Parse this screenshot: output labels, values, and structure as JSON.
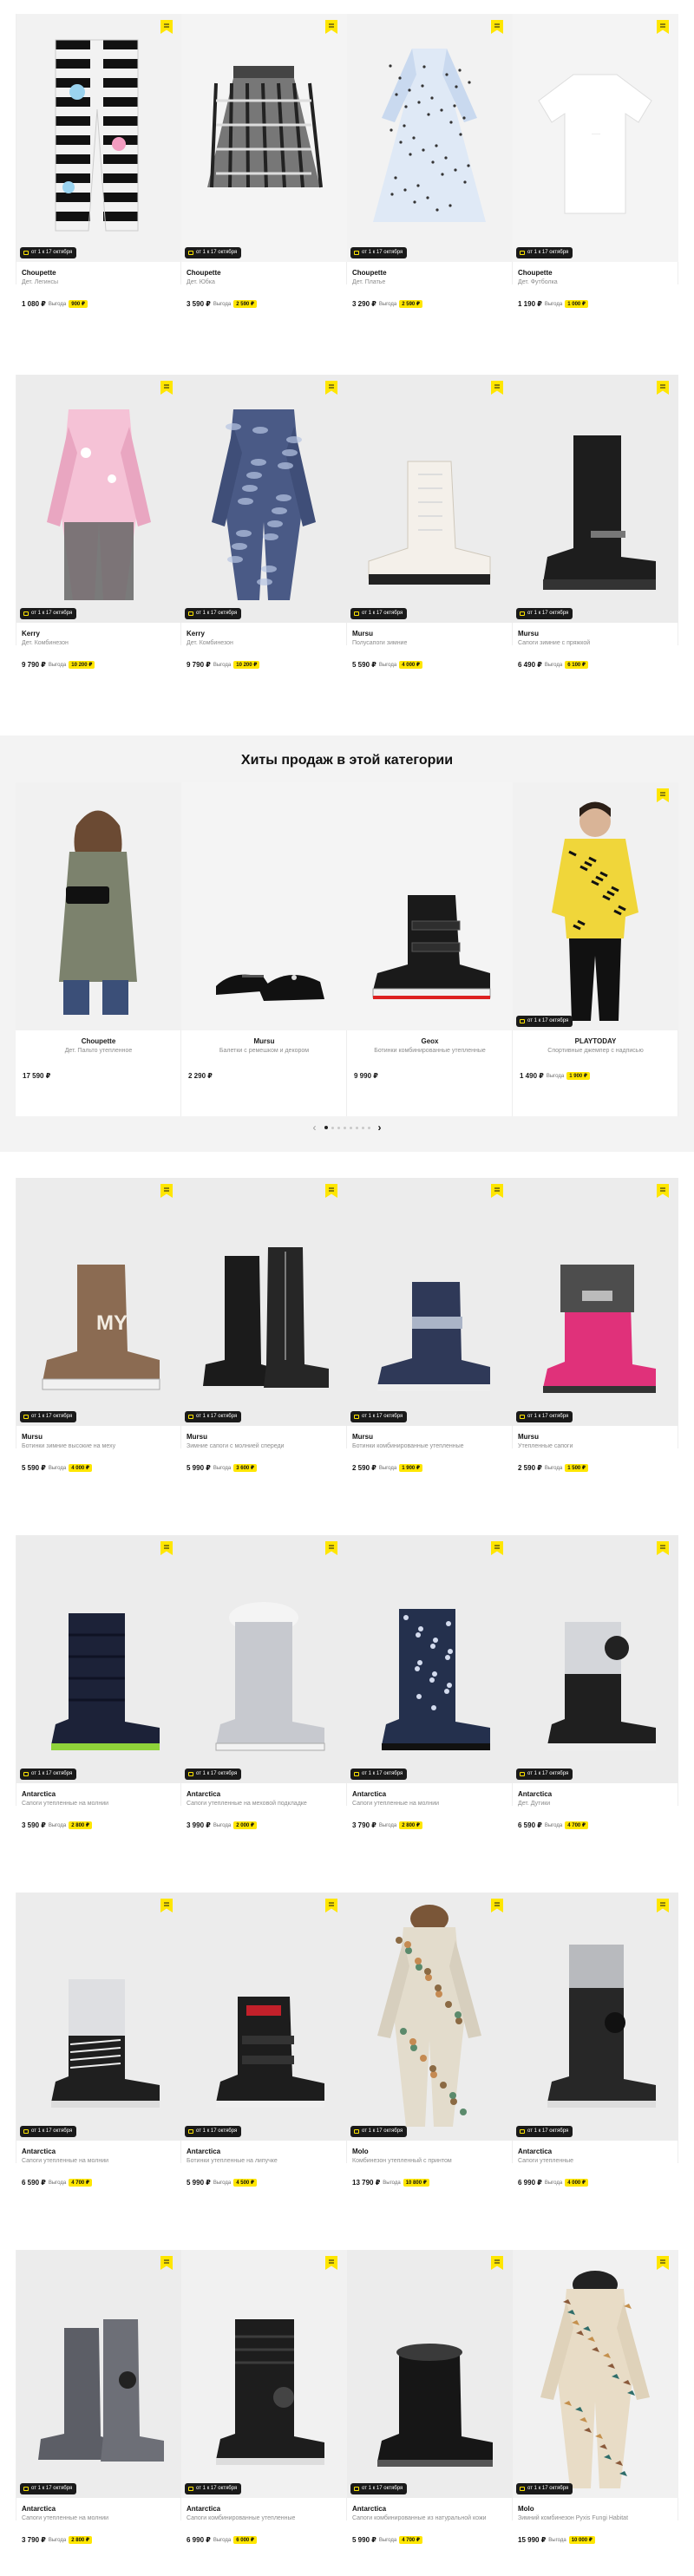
{
  "delivery_badge": "от 1 к 17 октября",
  "savings_label": "Выгода",
  "hits_title": "Хиты продаж в этой категории",
  "pager": {
    "prev": "‹",
    "next": "›",
    "count": 8,
    "active": 0
  },
  "rows": [
    [
      {
        "brand": "Choupette",
        "type": "Дет. Легинсы",
        "price": "1 080 ₽",
        "saving": "900 ₽",
        "kind": "leggings"
      },
      {
        "brand": "Choupette",
        "type": "Дет. Юбка",
        "price": "3 590 ₽",
        "saving": "2 590 ₽",
        "kind": "skirt"
      },
      {
        "brand": "Choupette",
        "type": "Дет. Платье",
        "price": "3 290 ₽",
        "saving": "2 590 ₽",
        "kind": "dress"
      },
      {
        "brand": "Choupette",
        "type": "Дет. Футболка",
        "price": "1 190 ₽",
        "saving": "1 000 ₽",
        "kind": "tshirt"
      }
    ],
    [
      {
        "brand": "Kerry",
        "type": "Дет. Комбинезон",
        "price": "9 790 ₽",
        "saving": "10 200 ₽",
        "kind": "snowsuit-pink"
      },
      {
        "brand": "Kerry",
        "type": "Дет. Комбинезон",
        "price": "9 790 ₽",
        "saving": "10 200 ₽",
        "kind": "snowsuit-camo"
      },
      {
        "brand": "Mursu",
        "type": "Полусапоги зимние",
        "price": "5 590 ₽",
        "saving": "4 000 ₽",
        "kind": "boot-white"
      },
      {
        "brand": "Mursu",
        "type": "Сапоги зимние с пряжкой",
        "price": "6 490 ₽",
        "saving": "6 100 ₽",
        "kind": "boot-tall-black"
      }
    ]
  ],
  "hits": [
    {
      "brand": "Choupette",
      "type": "Дет. Пальто утепленное",
      "price": "17 590 ₽",
      "saving": "",
      "kind": "girl-coat"
    },
    {
      "brand": "Mursu",
      "type": "Балетки с ремешком и декором",
      "price": "2 290 ₽",
      "saving": "",
      "kind": "ballet"
    },
    {
      "brand": "Geox",
      "type": "Ботинки комбинированные утепленные",
      "price": "9 990 ₽",
      "saving": "",
      "kind": "boot-geox"
    },
    {
      "brand": "PLAYTODAY",
      "type": "Спортивные джемпер с надписью",
      "price": "1 490 ₽",
      "saving": "1 900 ₽",
      "kind": "boy-yellow"
    }
  ],
  "rows2": [
    [
      {
        "brand": "Mursu",
        "type": "Ботинки зимние высокие на меху",
        "price": "5 590 ₽",
        "saving": "4 000 ₽",
        "kind": "boot-brown"
      },
      {
        "brand": "Mursu",
        "type": "Зимние сапоги с молнией спереди",
        "price": "5 990 ₽",
        "saving": "3 600 ₽",
        "kind": "boot-black-zip"
      },
      {
        "brand": "Mursu",
        "type": "Ботинки комбинированные утепленные",
        "price": "2 590 ₽",
        "saving": "1 900 ₽",
        "kind": "boot-navy"
      },
      {
        "brand": "Mursu",
        "type": "Утепленные сапоги",
        "price": "2 590 ₽",
        "saving": "1 500 ₽",
        "kind": "boot-pink"
      }
    ],
    [
      {
        "brand": "Antarctica",
        "type": "Сапоги утепленные на молнии",
        "price": "3 590 ₽",
        "saving": "2 800 ₽",
        "kind": "puffer-navy"
      },
      {
        "brand": "Antarctica",
        "type": "Сапоги утепленные на меховой подкладке",
        "price": "3 990 ₽",
        "saving": "2 000 ₽",
        "kind": "puffer-silver-fur"
      },
      {
        "brand": "Antarctica",
        "type": "Сапоги утепленные на молнии",
        "price": "3 790 ₽",
        "saving": "2 800 ₽",
        "kind": "puffer-print"
      },
      {
        "brand": "Antarctica",
        "type": "Дет. Дутики",
        "price": "6 590 ₽",
        "saving": "4 700 ₽",
        "kind": "puffer-silver-lace"
      }
    ],
    [
      {
        "brand": "Antarctica",
        "type": "Сапоги утепленные на молнии",
        "price": "6 590 ₽",
        "saving": "4 700 ₽",
        "kind": "puffer-silver-lace2"
      },
      {
        "brand": "Antarctica",
        "type": "Ботинки утепленные на липучке",
        "price": "5 990 ₽",
        "saving": "4 500 ₽",
        "kind": "boot-velcro"
      },
      {
        "brand": "Molo",
        "type": "Комбинезон утепленный с принтом",
        "price": "13 790 ₽",
        "saving": "10 800 ₽",
        "kind": "molo-suit"
      },
      {
        "brand": "Antarctica",
        "type": "Сапоги утепленные",
        "price": "6 990 ₽",
        "saving": "4 000 ₽",
        "kind": "puffer-black-tall"
      }
    ],
    [
      {
        "brand": "Antarctica",
        "type": "Сапоги утепленные на молнии",
        "price": "3 790 ₽",
        "saving": "2 800 ₽",
        "kind": "puffer-gunmetal"
      },
      {
        "brand": "Antarctica",
        "type": "Сапоги комбинированные утепленные",
        "price": "6 990 ₽",
        "saving": "6 000 ₽",
        "kind": "puffer-black-round"
      },
      {
        "brand": "Antarctica",
        "type": "Сапоги комбинированные из натуральной кожи",
        "price": "5 990 ₽",
        "saving": "4 700 ₽",
        "kind": "boot-fur-black"
      },
      {
        "brand": "Molo",
        "type": "Зимний комбинезон Pyxis Fungi Habitat",
        "price": "15 990 ₽",
        "saving": "10 000 ₽",
        "kind": "molo-suit2"
      }
    ]
  ]
}
